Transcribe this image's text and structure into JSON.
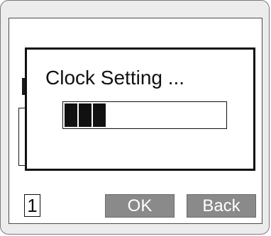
{
  "dialog": {
    "title": "Clock Setting ...",
    "progress": {
      "filled_segments": 3
    }
  },
  "footer": {
    "page_number": "1",
    "ok_label": "OK",
    "back_label": "Back"
  },
  "colors": {
    "screen_background": "#ffffff",
    "frame_background": "#ececec",
    "softkey_background": "#8a8a8a",
    "softkey_text": "#ffffff",
    "ink": "#111111"
  }
}
